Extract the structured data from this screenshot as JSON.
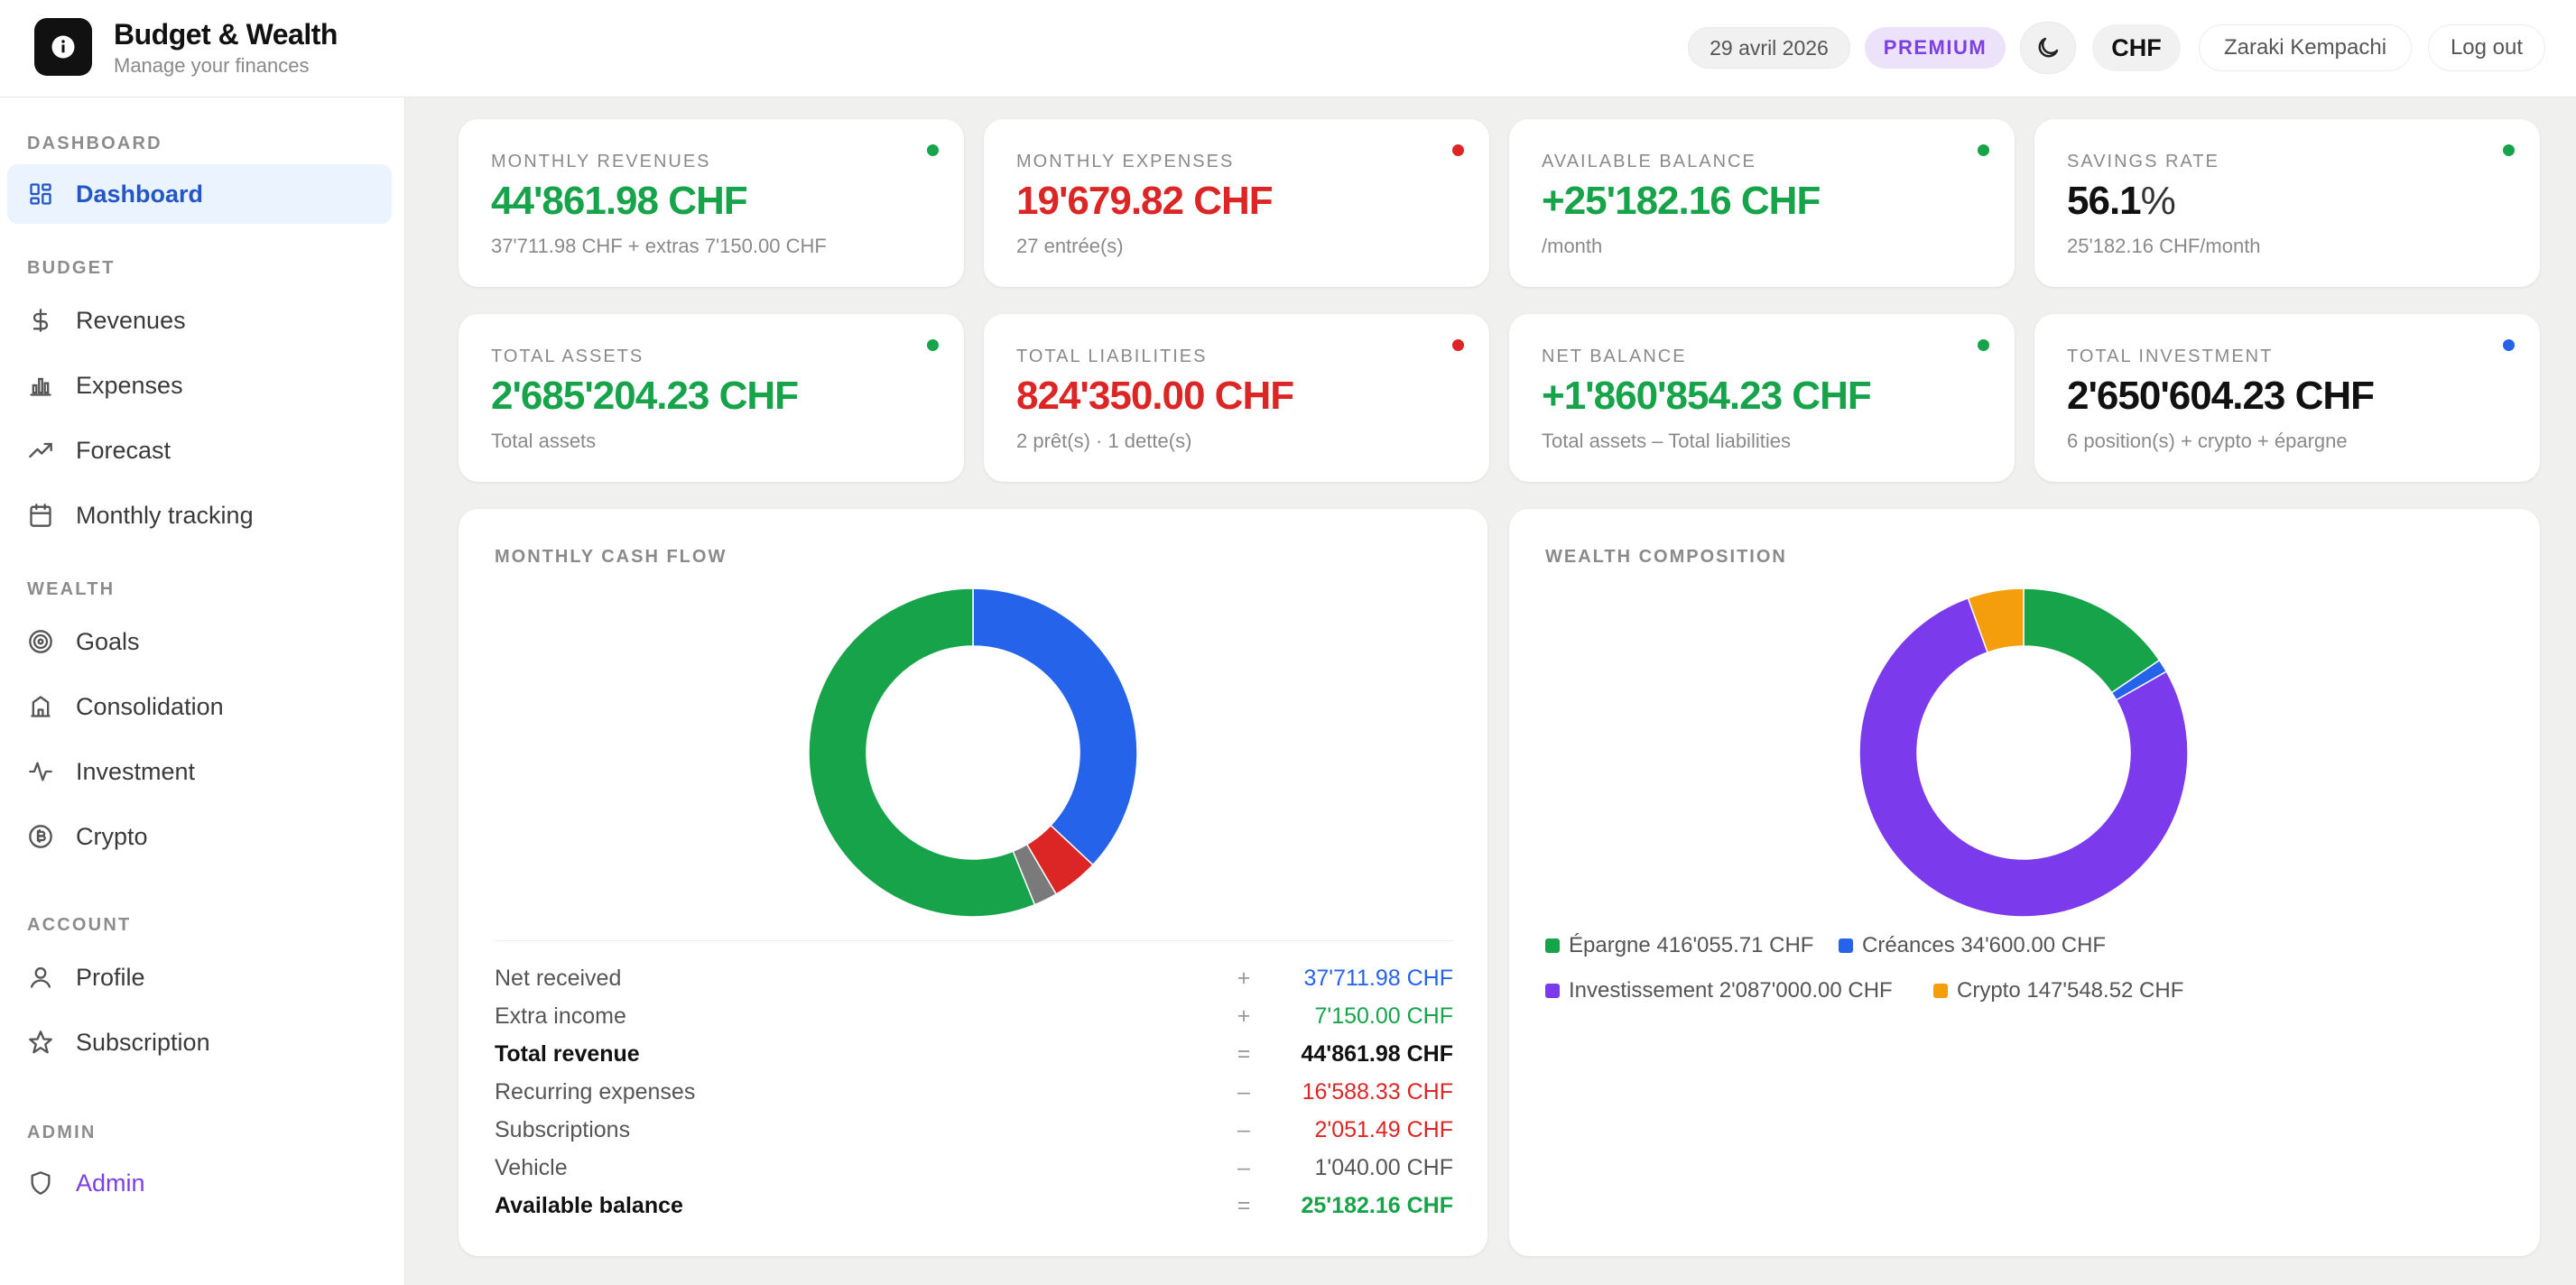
{
  "app": {
    "title": "Budget & Wealth",
    "subtitle": "Manage your finances",
    "logo_icon": "info-icon"
  },
  "header": {
    "date": "29 avril 2026",
    "plan": "PREMIUM",
    "theme_icon": "moon-icon",
    "currency": "CHF",
    "user": "Zaraki Kempachi",
    "logout": "Log out"
  },
  "sidebar": {
    "sections": [
      {
        "label": "DASHBOARD",
        "items": [
          {
            "label": "Dashboard",
            "icon": "dashboard-grid-icon",
            "active": true
          }
        ]
      },
      {
        "label": "BUDGET",
        "items": [
          {
            "label": "Revenues",
            "icon": "dollar-icon"
          },
          {
            "label": "Expenses",
            "icon": "bar-chart-icon"
          },
          {
            "label": "Forecast",
            "icon": "trending-up-icon"
          },
          {
            "label": "Monthly tracking",
            "icon": "calendar-icon"
          }
        ]
      },
      {
        "label": "WEALTH",
        "items": [
          {
            "label": "Goals",
            "icon": "target-icon"
          },
          {
            "label": "Consolidation",
            "icon": "bank-icon"
          },
          {
            "label": "Investment",
            "icon": "activity-icon"
          },
          {
            "label": "Crypto",
            "icon": "bitcoin-icon"
          }
        ]
      },
      {
        "label": "ACCOUNT",
        "items": [
          {
            "label": "Profile",
            "icon": "user-icon"
          },
          {
            "label": "Subscription",
            "icon": "star-icon"
          }
        ]
      },
      {
        "label": "ADMIN",
        "items": [
          {
            "label": "Admin",
            "icon": "shield-icon"
          }
        ]
      }
    ]
  },
  "stats": [
    {
      "label": "MONTHLY REVENUES",
      "value": "44'861.98 CHF",
      "sub": "37'711.98 CHF + extras 7'150.00 CHF",
      "tone": "green",
      "dot": "#16a34a"
    },
    {
      "label": "MONTHLY EXPENSES",
      "value": "19'679.82 CHF",
      "sub": "27 entrée(s)",
      "tone": "red",
      "dot": "#dc2626"
    },
    {
      "label": "AVAILABLE BALANCE",
      "value": "+25'182.16 CHF",
      "sub": "/month",
      "tone": "green",
      "dot": "#16a34a"
    },
    {
      "label": "SAVINGS RATE",
      "value": "56.1",
      "value_suffix": "%",
      "sub": "25'182.16 CHF/month",
      "tone": "dark",
      "dot": "#16a34a"
    },
    {
      "label": "TOTAL ASSETS",
      "value": "2'685'204.23 CHF",
      "sub": "Total assets",
      "tone": "green",
      "dot": "#16a34a"
    },
    {
      "label": "TOTAL LIABILITIES",
      "value": "824'350.00 CHF",
      "sub": "2 prêt(s) · 1 dette(s)",
      "tone": "red",
      "dot": "#dc2626"
    },
    {
      "label": "NET BALANCE",
      "value": "+1'860'854.23 CHF",
      "sub": "Total assets – Total liabilities",
      "tone": "green",
      "dot": "#16a34a"
    },
    {
      "label": "TOTAL INVESTMENT",
      "value": "2'650'604.23 CHF",
      "sub": "6 position(s) + crypto + épargne",
      "tone": "dark",
      "dot": "#2563eb"
    }
  ],
  "cashflow": {
    "title": "MONTHLY CASH FLOW",
    "rows": [
      {
        "label": "Net received",
        "op": "+",
        "value": "37'711.98 CHF",
        "color": "#2563eb",
        "bold": false
      },
      {
        "label": "Extra income",
        "op": "+",
        "value": "7'150.00 CHF",
        "color": "#16a34a",
        "bold": false
      },
      {
        "label": "Total revenue",
        "op": "=",
        "value": "44'861.98 CHF",
        "color": "#111111",
        "bold": true
      },
      {
        "label": "Recurring expenses",
        "op": "–",
        "value": "16'588.33 CHF",
        "color": "#dc2626",
        "bold": false
      },
      {
        "label": "Subscriptions",
        "op": "–",
        "value": "2'051.49 CHF",
        "color": "#dc2626",
        "bold": false
      },
      {
        "label": "Vehicle",
        "op": "–",
        "value": "1'040.00 CHF",
        "color": "#555555",
        "bold": false
      },
      {
        "label": "Available balance",
        "op": "=",
        "value": "25'182.16 CHF",
        "color": "#16a34a",
        "bold": true
      }
    ]
  },
  "chart_data": [
    {
      "type": "pie",
      "categories": [
        "Recurring expenses",
        "Subscriptions",
        "Vehicle",
        "Available balance"
      ],
      "values": [
        16588.33,
        2051.49,
        1040.0,
        25182.16
      ],
      "colors": [
        "#2563eb",
        "#dc2626",
        "#7a7a7a",
        "#16a34a"
      ],
      "donut": true
    },
    {
      "type": "pie",
      "title": "WEALTH COMPOSITION",
      "categories": [
        "Épargne",
        "Créances",
        "Investissement",
        "Crypto"
      ],
      "values": [
        416055.71,
        34600.0,
        2087000.0,
        147548.52
      ],
      "colors": [
        "#16a34a",
        "#2563eb",
        "#7c3aed",
        "#f59e0b"
      ],
      "legend_labels": [
        "Épargne 416'055.71 CHF",
        "Créances 34'600.00 CHF",
        "Investissement 2'087'000.00 CHF",
        "Crypto 147'548.52 CHF"
      ],
      "donut": true
    }
  ]
}
